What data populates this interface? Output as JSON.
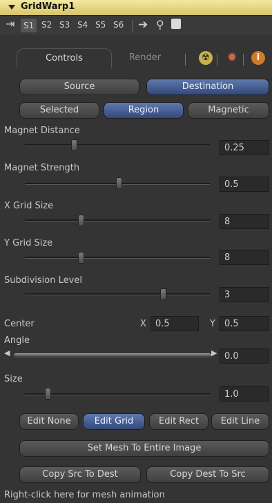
{
  "header": {
    "title": "GridWarp1"
  },
  "toolbar": {
    "slots": [
      "S1",
      "S2",
      "S3",
      "S4",
      "S5",
      "S6"
    ]
  },
  "tabs": {
    "controls": "Controls",
    "render": "Render"
  },
  "source_dest": {
    "source": "Source",
    "destination": "Destination"
  },
  "mode": {
    "selected": "Selected",
    "region": "Region",
    "magnetic": "Magnetic"
  },
  "sliders": [
    {
      "label": "Magnet Distance",
      "value": "0.25"
    },
    {
      "label": "Magnet Strength",
      "value": "0.5"
    },
    {
      "label": "X Grid Size",
      "value": "8"
    },
    {
      "label": "Y Grid Size",
      "value": "8"
    },
    {
      "label": "Subdivision Level",
      "value": "3"
    }
  ],
  "center": {
    "label": "Center",
    "x_label": "X",
    "x_value": "0.5",
    "y_label": "Y",
    "y_value": "0.5"
  },
  "angle": {
    "label": "Angle",
    "value": "0.0"
  },
  "size": {
    "label": "Size",
    "value": "1.0"
  },
  "edit": {
    "none": "Edit None",
    "grid": "Edit Grid",
    "rect": "Edit Rect",
    "line": "Edit Line"
  },
  "actions": {
    "set_mesh": "Set Mesh To Entire Image",
    "copy_src": "Copy Src To Dest",
    "copy_dest": "Copy Dest To Src"
  },
  "footer": {
    "hint": "Right-click here for mesh animation"
  }
}
